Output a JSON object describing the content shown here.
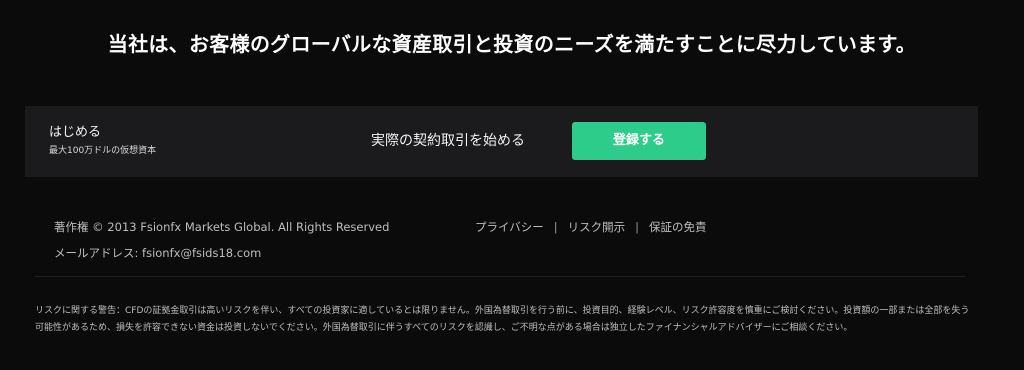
{
  "headline": "当社は、お客様のグローバルな資産取引と投資のニーズを満たすことに尽力しています。",
  "cta": {
    "title": "はじめる",
    "subtitle": "最大100万ドルの仮想資本",
    "middle_text": "実際の契約取引を始める",
    "button_label": "登録する",
    "button_color": "#2ecc8b",
    "bar_color": "#1b1b1d"
  },
  "footer": {
    "copyright": "著作権 © 2013 Fsionfx Markets Global. All Rights Reserved",
    "email": "メールアドレス: fsionfx@fsids18.com",
    "links": [
      "プライバシー",
      "リスク開示",
      "保証の免責"
    ],
    "separator": "|"
  },
  "risk_warning": "リスクに関する警告：CFDの証拠金取引は高いリスクを伴い、すべての投資家に適しているとは限りません。外国為替取引を行う前に、投資目的、経験レベル、リスク許容度を慎重にご検討ください。投資額の一部または全部を失う可能性があるため、損失を許容できない資金は投資しないでください。外国為替取引に伴うすべてのリスクを認識し、ご不明な点がある場合は独立したファイナンシャルアドバイザーにご相談ください。"
}
